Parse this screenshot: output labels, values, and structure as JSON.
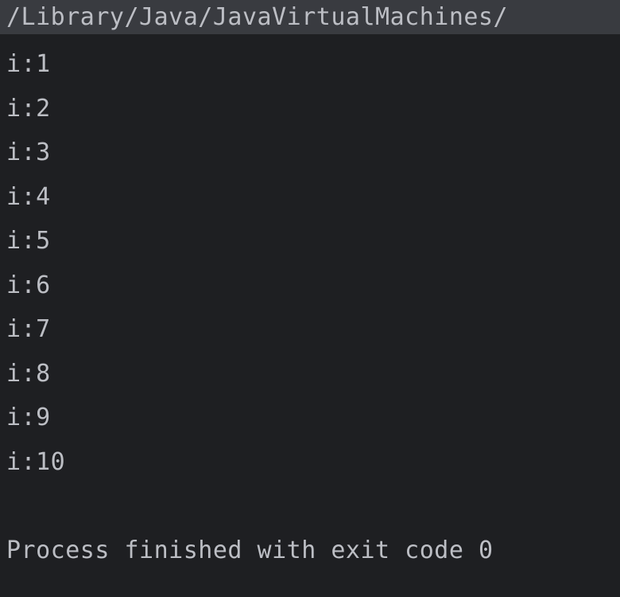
{
  "console": {
    "command_path": "/Library/Java/JavaVirtualMachines/",
    "output_lines": [
      "i:1",
      "i:2",
      "i:3",
      "i:4",
      "i:5",
      "i:6",
      "i:7",
      "i:8",
      "i:9",
      "i:10"
    ],
    "status_message": "Process finished with exit code 0"
  }
}
